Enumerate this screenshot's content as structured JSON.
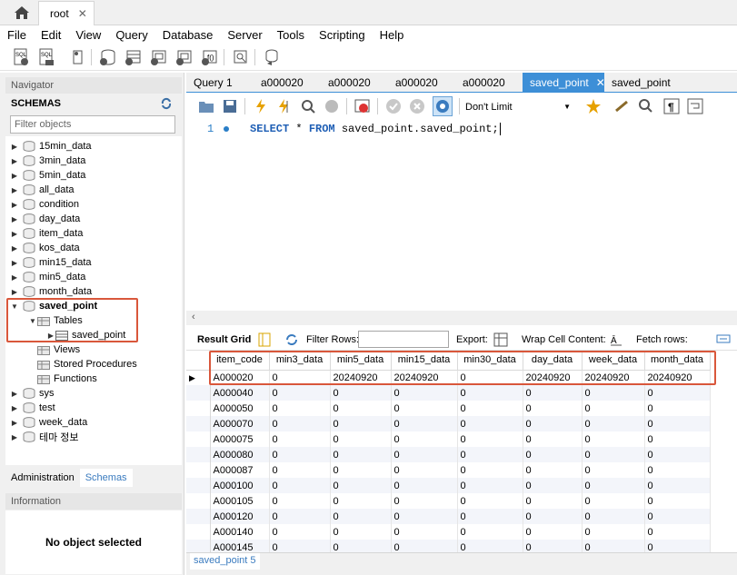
{
  "window": {
    "tab_label": "root",
    "tab_close": "✕"
  },
  "menu": [
    "File",
    "Edit",
    "View",
    "Query",
    "Database",
    "Server",
    "Tools",
    "Scripting",
    "Help"
  ],
  "navigator": {
    "header": "Navigator",
    "schemas_label": "SCHEMAS",
    "filter_placeholder": "Filter objects",
    "schemas": [
      "15min_data",
      "3min_data",
      "5min_data",
      "all_data",
      "condition",
      "day_data",
      "item_data",
      "kos_data",
      "min15_data",
      "min5_data",
      "month_data"
    ],
    "expanded_schema": "saved_point",
    "tables_label": "Tables",
    "table_item": "saved_point",
    "views_label": "Views",
    "procs_label": "Stored Procedures",
    "funcs_label": "Functions",
    "schemas_after": [
      "sys",
      "test",
      "week_data",
      "테마 정보"
    ],
    "bottom_tabs": [
      "Administration",
      "Schemas"
    ],
    "info_header": "Information",
    "info_body": "No object selected"
  },
  "query_tabs": [
    "Query 1",
    "a000020",
    "a000020",
    "a000020",
    "a000020",
    "saved_point",
    "saved_point"
  ],
  "active_query_tab": 5,
  "query_toolbar": {
    "limit": "Don't Limit"
  },
  "editor": {
    "line_number": "1",
    "sql_kw1": "SELECT",
    "sql_star": " * ",
    "sql_kw2": "FROM",
    "sql_rest": " saved_point.saved_point;"
  },
  "result_toolbar": {
    "result_grid": "Result Grid",
    "filter_rows": "Filter Rows:",
    "export": "Export:",
    "wrap": "Wrap Cell Content:",
    "fetch": "Fetch rows:"
  },
  "grid": {
    "columns": [
      "item_code",
      "min3_data",
      "min5_data",
      "min15_data",
      "min30_data",
      "day_data",
      "week_data",
      "month_data"
    ],
    "rows": [
      [
        "A000020",
        "0",
        "20240920",
        "20240920",
        "0",
        "20240920",
        "20240920",
        "20240920"
      ],
      [
        "A000040",
        "0",
        "0",
        "0",
        "0",
        "0",
        "0",
        "0"
      ],
      [
        "A000050",
        "0",
        "0",
        "0",
        "0",
        "0",
        "0",
        "0"
      ],
      [
        "A000070",
        "0",
        "0",
        "0",
        "0",
        "0",
        "0",
        "0"
      ],
      [
        "A000075",
        "0",
        "0",
        "0",
        "0",
        "0",
        "0",
        "0"
      ],
      [
        "A000080",
        "0",
        "0",
        "0",
        "0",
        "0",
        "0",
        "0"
      ],
      [
        "A000087",
        "0",
        "0",
        "0",
        "0",
        "0",
        "0",
        "0"
      ],
      [
        "A000100",
        "0",
        "0",
        "0",
        "0",
        "0",
        "0",
        "0"
      ],
      [
        "A000105",
        "0",
        "0",
        "0",
        "0",
        "0",
        "0",
        "0"
      ],
      [
        "A000120",
        "0",
        "0",
        "0",
        "0",
        "0",
        "0",
        "0"
      ],
      [
        "A000140",
        "0",
        "0",
        "0",
        "0",
        "0",
        "0",
        "0"
      ],
      [
        "A000145",
        "0",
        "0",
        "0",
        "0",
        "0",
        "0",
        "0"
      ]
    ]
  },
  "bottom_tab": "saved_point 5"
}
